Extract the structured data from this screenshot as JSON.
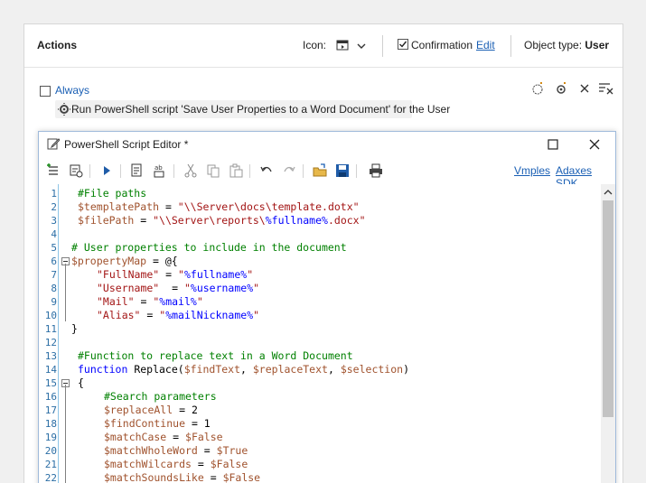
{
  "actions": {
    "title": "Actions",
    "icon_label": "Icon:",
    "confirmation_label": "Confirmation",
    "edit_label": "Edit",
    "object_type_label": "Object type:",
    "object_type_value": "User"
  },
  "condition": {
    "always_label": "Always",
    "action_text": "Run PowerShell script 'Save User Properties to a Word Document' for the User"
  },
  "editor": {
    "title": "PowerShell Script Editor *",
    "links": [
      "Vmples",
      "Adaxes SDK"
    ],
    "lines": [
      {
        "n": "1",
        "parts": [
          [
            "c-com",
            "#File paths"
          ]
        ],
        "indent": 1
      },
      {
        "n": "2",
        "parts": [
          [
            "c-var",
            "$templatePath"
          ],
          [
            "c-pl",
            " = "
          ],
          [
            "c-str",
            "\"\\\\Server\\docs\\template.dotx\""
          ]
        ],
        "indent": 1
      },
      {
        "n": "3",
        "parts": [
          [
            "c-var",
            "$filePath"
          ],
          [
            "c-pl",
            " = "
          ],
          [
            "c-str",
            "\"\\\\Server\\reports\\"
          ],
          [
            "c-strvar",
            "%fullname%"
          ],
          [
            "c-str",
            ".docx\""
          ]
        ],
        "indent": 1
      },
      {
        "n": "4",
        "parts": [],
        "indent": 0
      },
      {
        "n": "5",
        "parts": [
          [
            "c-com",
            "# User properties to include in the document"
          ]
        ],
        "indent": 0
      },
      {
        "n": "6",
        "parts": [
          [
            "c-var",
            "$propertyMap"
          ],
          [
            "c-pl",
            " = @{"
          ]
        ],
        "indent": 0
      },
      {
        "n": "7",
        "parts": [
          [
            "c-str",
            "\"FullName\""
          ],
          [
            "c-pl",
            " = "
          ],
          [
            "c-str",
            "\""
          ],
          [
            "c-strvar",
            "%fullname%"
          ],
          [
            "c-str",
            "\""
          ]
        ],
        "indent": 2
      },
      {
        "n": "8",
        "parts": [
          [
            "c-str",
            "\"Username\""
          ],
          [
            "c-pl",
            "  = "
          ],
          [
            "c-str",
            "\""
          ],
          [
            "c-strvar",
            "%username%"
          ],
          [
            "c-str",
            "\""
          ]
        ],
        "indent": 2
      },
      {
        "n": "9",
        "parts": [
          [
            "c-str",
            "\"Mail\""
          ],
          [
            "c-pl",
            " = "
          ],
          [
            "c-str",
            "\""
          ],
          [
            "c-strvar",
            "%mail%"
          ],
          [
            "c-str",
            "\""
          ]
        ],
        "indent": 2
      },
      {
        "n": "10",
        "parts": [
          [
            "c-str",
            "\"Alias\""
          ],
          [
            "c-pl",
            " = "
          ],
          [
            "c-str",
            "\""
          ],
          [
            "c-strvar",
            "%mailNickname%"
          ],
          [
            "c-str",
            "\""
          ]
        ],
        "indent": 2
      },
      {
        "n": "11",
        "parts": [
          [
            "c-pl",
            "}"
          ]
        ],
        "indent": 0
      },
      {
        "n": "12",
        "parts": [],
        "indent": 0
      },
      {
        "n": "13",
        "parts": [
          [
            "c-com",
            "#Function to replace text in a Word Document"
          ]
        ],
        "indent": 1
      },
      {
        "n": "14",
        "parts": [
          [
            "c-kw",
            "function"
          ],
          [
            "c-pl",
            " Replace("
          ],
          [
            "c-var",
            "$findText"
          ],
          [
            "c-pl",
            ", "
          ],
          [
            "c-var",
            "$replaceText"
          ],
          [
            "c-pl",
            ", "
          ],
          [
            "c-var",
            "$selection"
          ],
          [
            "c-pl",
            ")"
          ]
        ],
        "indent": 1
      },
      {
        "n": "15",
        "parts": [
          [
            "c-pl",
            "{"
          ]
        ],
        "indent": 1
      },
      {
        "n": "16",
        "parts": [
          [
            "c-com",
            "#Search parameters"
          ]
        ],
        "indent": 3
      },
      {
        "n": "17",
        "parts": [
          [
            "c-var",
            "$replaceAll"
          ],
          [
            "c-pl",
            " = 2"
          ]
        ],
        "indent": 3
      },
      {
        "n": "18",
        "parts": [
          [
            "c-var",
            "$findContinue"
          ],
          [
            "c-pl",
            " = 1"
          ]
        ],
        "indent": 3
      },
      {
        "n": "19",
        "parts": [
          [
            "c-var",
            "$matchCase"
          ],
          [
            "c-pl",
            " = "
          ],
          [
            "c-var",
            "$False"
          ]
        ],
        "indent": 3
      },
      {
        "n": "20",
        "parts": [
          [
            "c-var",
            "$matchWholeWord"
          ],
          [
            "c-pl",
            " = "
          ],
          [
            "c-var",
            "$True"
          ]
        ],
        "indent": 3
      },
      {
        "n": "21",
        "parts": [
          [
            "c-var",
            "$matchWilcards"
          ],
          [
            "c-pl",
            " = "
          ],
          [
            "c-var",
            "$False"
          ]
        ],
        "indent": 3
      },
      {
        "n": "22",
        "parts": [
          [
            "c-var",
            "$matchSoundsLike"
          ],
          [
            "c-pl",
            " = "
          ],
          [
            "c-var",
            "$False"
          ]
        ],
        "indent": 3
      }
    ]
  }
}
